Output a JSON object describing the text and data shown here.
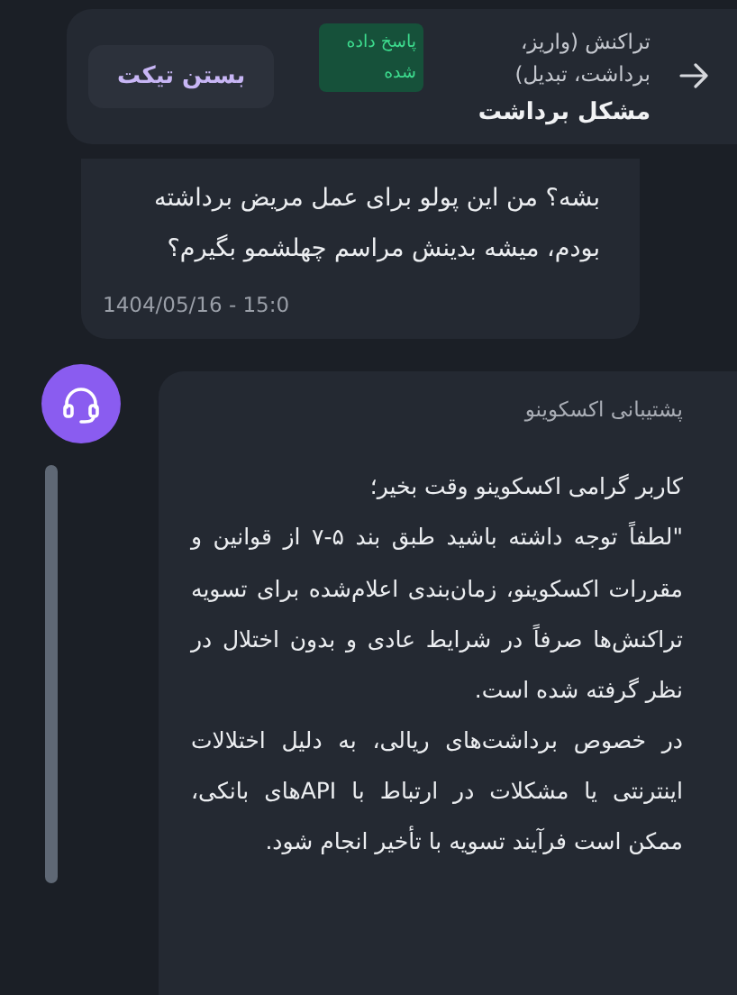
{
  "header": {
    "category": "تراکنش (واریز، برداشت، تبدیل)",
    "subject": "مشکل برداشت",
    "status": "پاسخ داده شده",
    "close_button": "بستن تیکت"
  },
  "messages": [
    {
      "kind": "user",
      "text": "بشه؟ من  این پولو برای عمل مریض برداشته بودم، میشه بدینش مراسم چهلشمو بگیرم؟",
      "time": "1404/05/16 - 15:0"
    },
    {
      "kind": "support",
      "author": "پشتیبانی اکسکوینو",
      "paragraphs": [
        "کاربر گرامی اکسکوینو وقت بخیر؛",
        "\"لطفاً توجه داشته باشید طبق بند ۵-۷ از قوانین و مقررات اکسکوینو، زمان‌بندی اعلام‌شده برای تسویه تراکنش‌ها صرفاً در شرایط عادی و بدون اختلال در نظر گرفته شده است.",
        "در خصوص برداشت‌های ریالی، به دلیل اختلالات اینترنتی یا مشکلات در ارتباط با APIهای بانکی، ممکن است فرآیند تسویه با تأخیر انجام شود."
      ]
    }
  ]
}
